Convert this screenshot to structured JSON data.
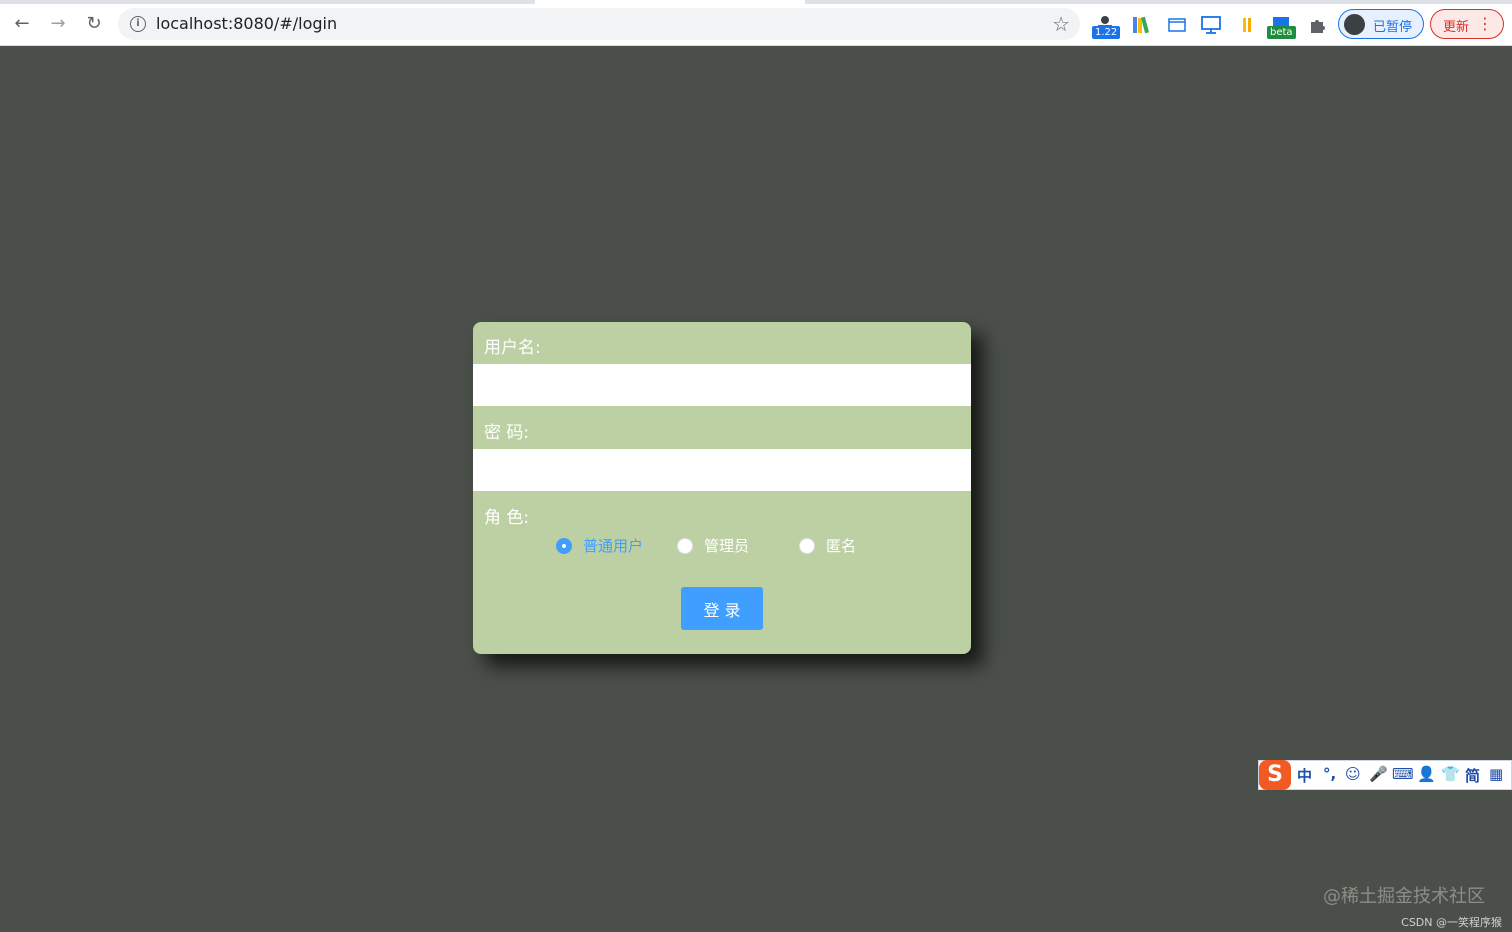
{
  "browser": {
    "url": "localhost:8080/#/login",
    "back_icon": "←",
    "forward_icon": "→",
    "reload_icon": "↻",
    "info_icon": "i",
    "star_icon": "☆",
    "extensions": [
      {
        "name": "ext-speed",
        "badge": "1.22",
        "badge_color": "#1a73e8"
      },
      {
        "name": "ext-books"
      },
      {
        "name": "ext-window"
      },
      {
        "name": "ext-screen"
      },
      {
        "name": "ext-if"
      },
      {
        "name": "ext-beta",
        "badge": "beta",
        "badge_color": "#1e8e3e"
      },
      {
        "name": "puzzle-icon"
      }
    ],
    "profile_status": "已暂停",
    "update_label": "更新",
    "menu_icon": "⋮"
  },
  "login": {
    "username_label": "用户名:",
    "password_label": "密 码:",
    "role_label": "角 色:",
    "roles": [
      {
        "label": "普通用户",
        "checked": true
      },
      {
        "label": "管理员",
        "checked": false
      },
      {
        "label": "匿名",
        "checked": false
      }
    ],
    "submit_label": "登 录",
    "accent_color": "#409eff",
    "card_color": "#bdd0a4"
  },
  "ime": {
    "logo": "S",
    "items": [
      "中",
      "°,",
      "☺",
      "🎤",
      "⌨",
      "👤",
      "👕",
      "简",
      "▦"
    ]
  },
  "watermark": {
    "main": "@稀土掘金技术社区",
    "sub": "CSDN @一笑程序猴"
  }
}
